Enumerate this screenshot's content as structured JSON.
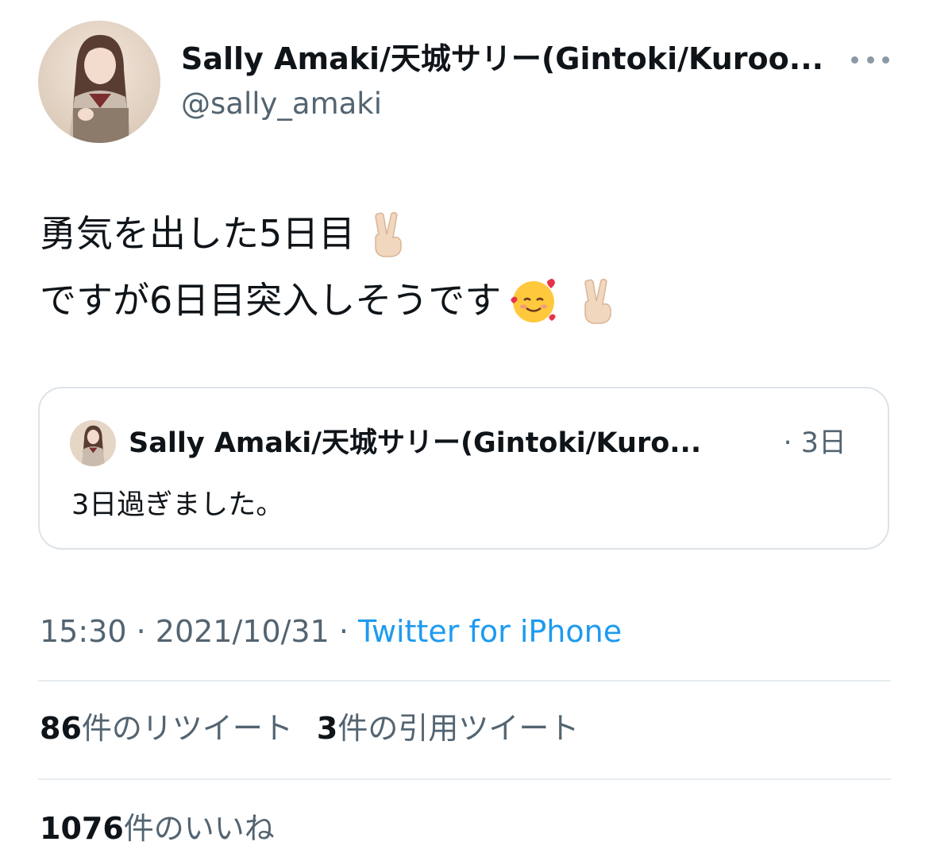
{
  "tweet": {
    "display_name": "Sally Amaki/天城サリー(Gintoki/Kuroo...",
    "handle": "@sally_amaki",
    "text_line_1": "勇気を出した5日目",
    "text_line_2": "ですが6日目突入しそうです",
    "emojis": [
      "victory-hand",
      "smiling-face-with-hearts",
      "victory-hand"
    ]
  },
  "quoted": {
    "display_name": "Sally Amaki/天城サリー(Gintoki/Kuro...",
    "time": "· 3日",
    "text": "3日過ぎました。"
  },
  "meta": {
    "time": "15:30",
    "sep1": " · ",
    "date": "2021/10/31",
    "sep2": " · ",
    "source": "Twitter for iPhone"
  },
  "stats": {
    "retweets_count": "86",
    "retweets_label": "件のリツイート",
    "quotes_count": "3",
    "quotes_label": "件の引用ツイート",
    "likes_count": "1076",
    "likes_label": "件のいいね"
  },
  "colors": {
    "text": "#0f1419",
    "secondary": "#536471",
    "link": "#1d9bf0",
    "border": "#dde3e8"
  }
}
